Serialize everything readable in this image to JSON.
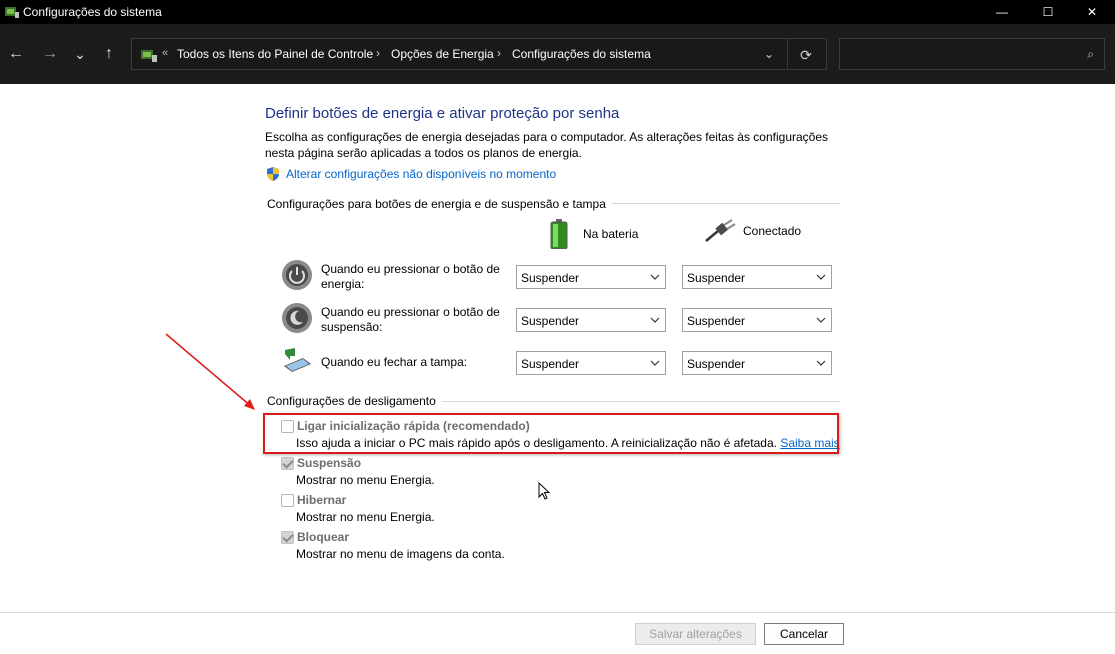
{
  "window": {
    "title": "Configurações do sistema",
    "minimize_glyph": "—",
    "maximize_glyph": "☐",
    "close_glyph": "✕"
  },
  "nav": {
    "back_glyph": "←",
    "forward_glyph": "→",
    "recent_glyph": "⌄",
    "up_glyph": "↑"
  },
  "address": {
    "overflow": "«",
    "crumbs": [
      "Todos os Itens do Painel de Controle",
      "Opções de Energia",
      "Configurações do sistema"
    ],
    "separator": "›",
    "dropdown_glyph": "⌄",
    "refresh_glyph": "⟳"
  },
  "search": {
    "placeholder": "",
    "icon": "search-icon",
    "icon_glyph": "⌕"
  },
  "page": {
    "heading": "Definir botões de energia e ativar proteção por senha",
    "description": "Escolha as configurações de energia desejadas para o computador. As alterações feitas às configurações nesta página serão aplicadas a todos os planos de energia.",
    "admin_link": "Alterar configurações não disponíveis no momento"
  },
  "power_buttons": {
    "section_title": "Configurações para botões de energia e de suspensão e tampa",
    "col_battery": "Na bateria",
    "col_plugged": "Conectado",
    "rows": [
      {
        "label": "Quando eu pressionar o botão de energia:",
        "battery": "Suspender",
        "plugged": "Suspender",
        "icon": "power-button-icon"
      },
      {
        "label": "Quando eu pressionar o botão de suspensão:",
        "battery": "Suspender",
        "plugged": "Suspender",
        "icon": "sleep-button-icon"
      },
      {
        "label": "Quando eu fechar a tampa:",
        "battery": "Suspender",
        "plugged": "Suspender",
        "icon": "laptop-lid-icon"
      }
    ]
  },
  "shutdown": {
    "section_title": "Configurações de desligamento",
    "items": [
      {
        "title": "Ligar inicialização rápida (recomendado)",
        "desc": "Isso ajuda a iniciar o PC mais rápido após o desligamento. A reinicialização não é afetada.",
        "link": "Saiba mais",
        "checked": false
      },
      {
        "title": "Suspensão",
        "desc": "Mostrar no menu Energia.",
        "checked": true
      },
      {
        "title": "Hibernar",
        "desc": "Mostrar no menu Energia.",
        "checked": false
      },
      {
        "title": "Bloquear",
        "desc": "Mostrar no menu de imagens da conta.",
        "checked": true
      }
    ]
  },
  "footer": {
    "save_label": "Salvar alterações",
    "cancel_label": "Cancelar"
  },
  "colors": {
    "heading": "#1e3287",
    "link": "#0066cc",
    "highlight": "#d91a1a",
    "titlebar": "#000000",
    "addressbar": "#1c1c1c"
  }
}
